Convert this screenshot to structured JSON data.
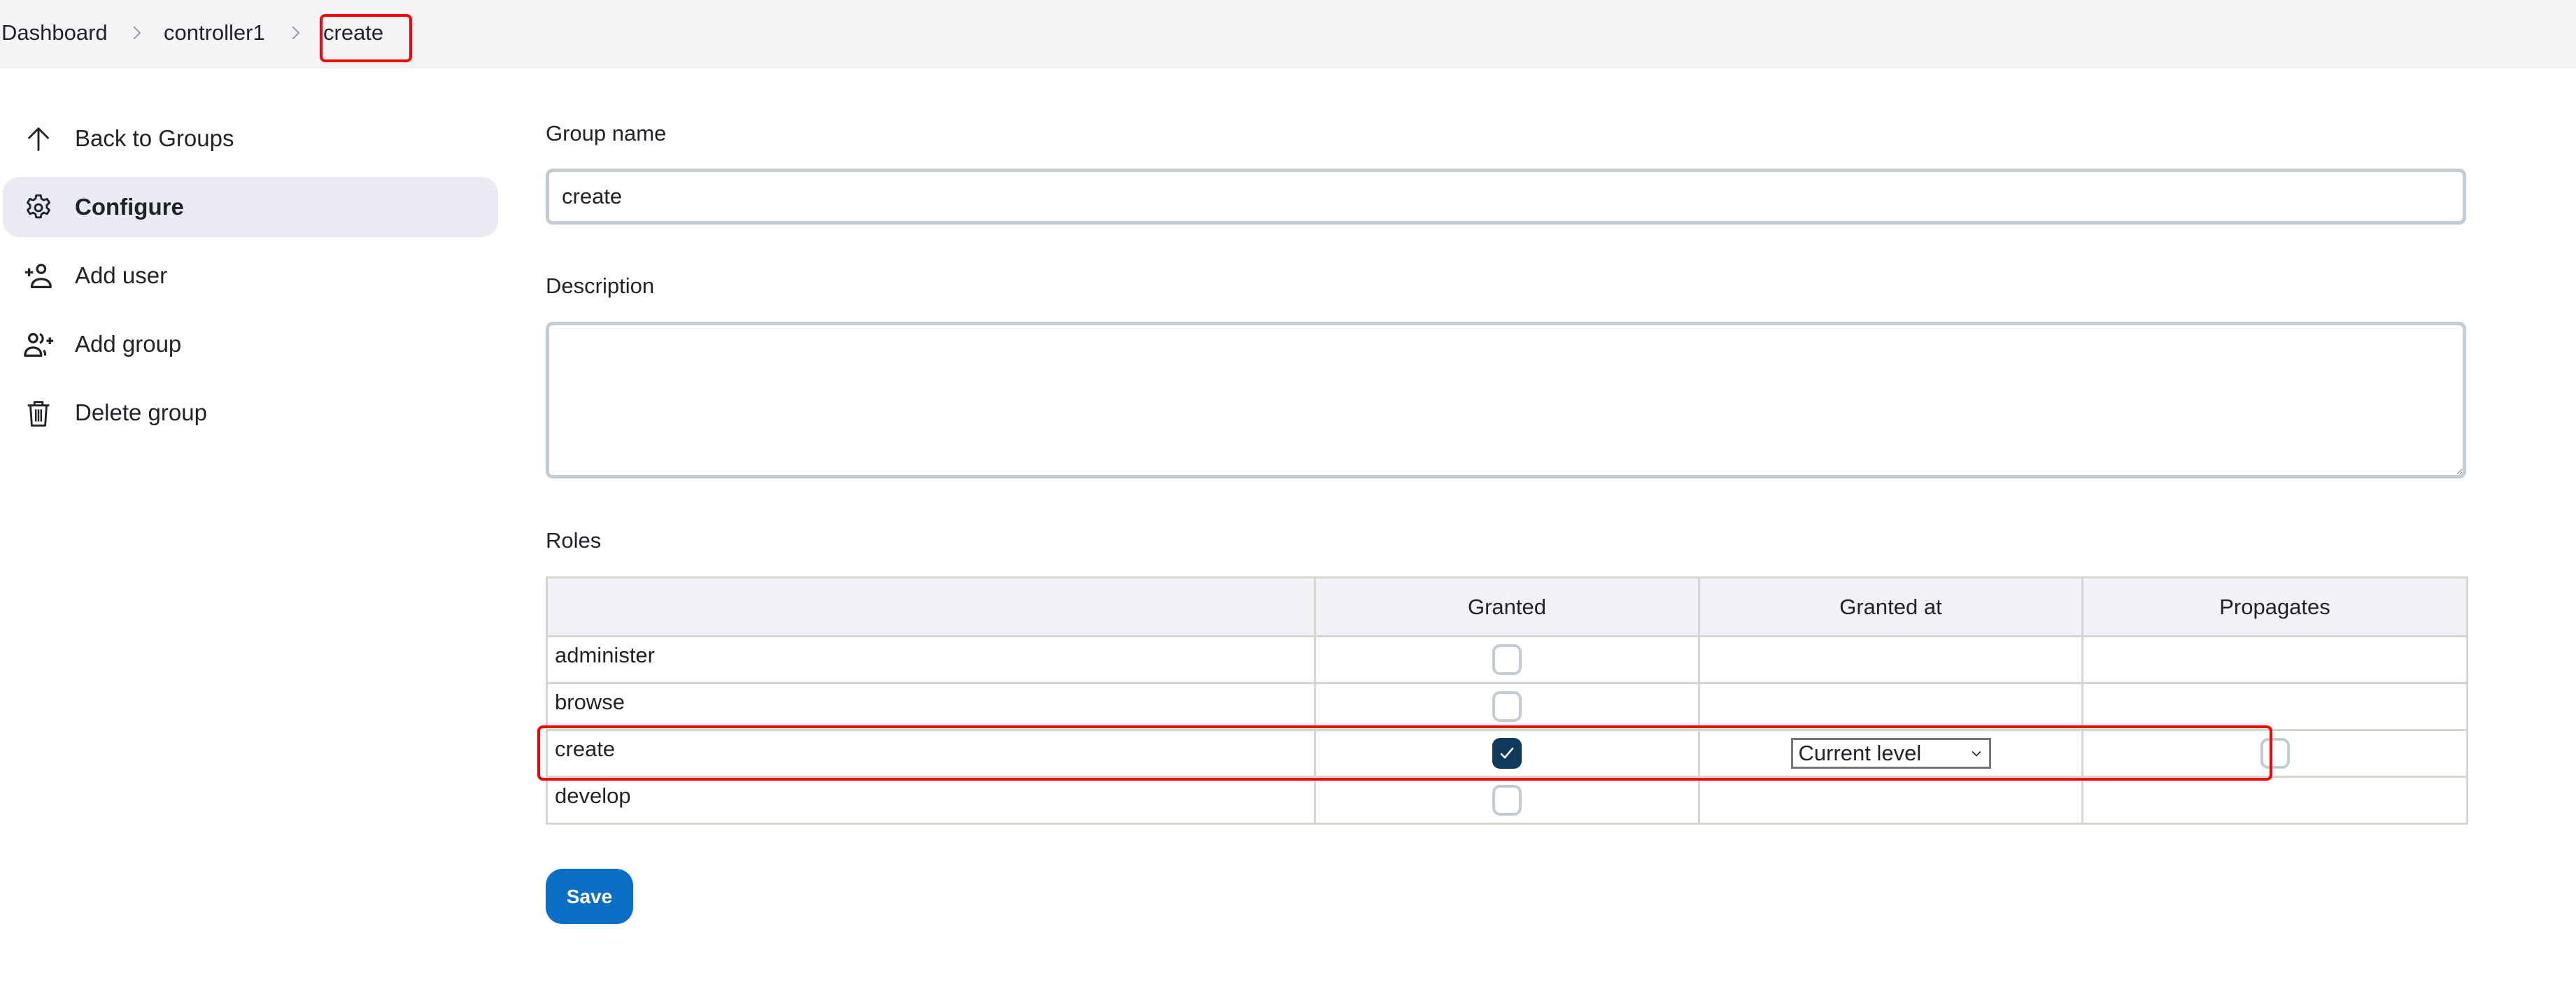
{
  "breadcrumb": {
    "items": [
      "Dashboard",
      "controller1",
      "create"
    ],
    "separator_icon": "chevron-right-icon"
  },
  "sidebar": {
    "items": [
      {
        "label": "Back to Groups",
        "icon": "arrow-up-icon",
        "active": false
      },
      {
        "label": "Configure",
        "icon": "gear-icon",
        "active": true
      },
      {
        "label": "Add user",
        "icon": "user-plus-icon",
        "active": false
      },
      {
        "label": "Add group",
        "icon": "users-plus-icon",
        "active": false
      },
      {
        "label": "Delete group",
        "icon": "trash-icon",
        "active": false
      }
    ]
  },
  "form": {
    "group_name_label": "Group name",
    "group_name_value": "create",
    "description_label": "Description",
    "description_value": "",
    "roles_label": "Roles"
  },
  "roles_table": {
    "headers": [
      "",
      "Granted",
      "Granted at",
      "Propagates"
    ],
    "rows": [
      {
        "role": "administer",
        "granted": false,
        "granted_at": null,
        "propagates": null
      },
      {
        "role": "browse",
        "granted": false,
        "granted_at": null,
        "propagates": null
      },
      {
        "role": "create",
        "granted": true,
        "granted_at": "Current level",
        "propagates": false
      },
      {
        "role": "develop",
        "granted": false,
        "granted_at": null,
        "propagates": null
      }
    ]
  },
  "actions": {
    "save_label": "Save"
  },
  "colors": {
    "accent": "#0b6fc8",
    "checkbox_checked": "#0e3a5c",
    "highlight": "#ff0000",
    "breadcrumb_bg": "#f4f4f6",
    "active_nav_bg": "#eaeaf3"
  }
}
